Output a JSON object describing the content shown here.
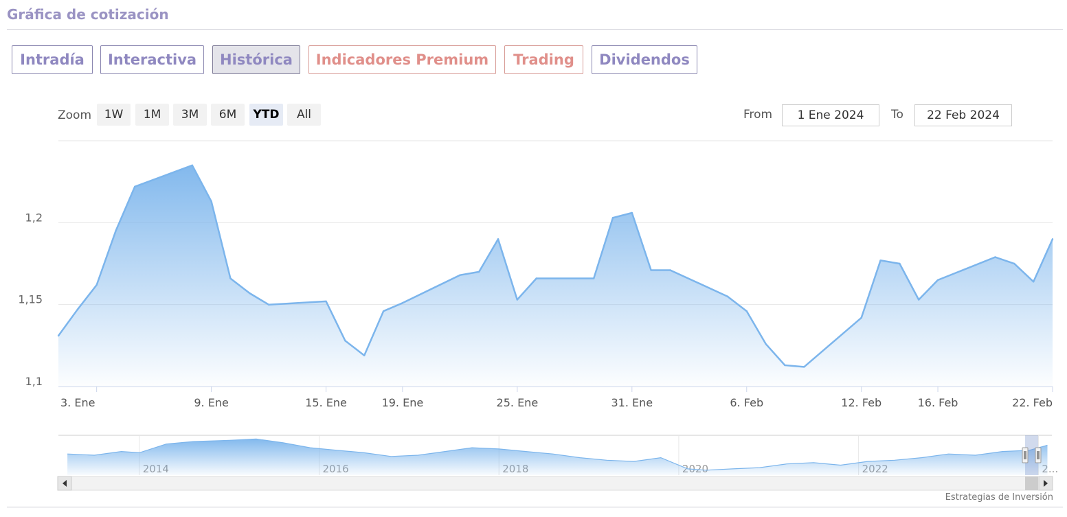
{
  "section_title": "Gráfica de cotización",
  "tabs": [
    {
      "label": "Intradía",
      "active": false,
      "premium": false
    },
    {
      "label": "Interactiva",
      "active": false,
      "premium": false
    },
    {
      "label": "Histórica",
      "active": true,
      "premium": false
    },
    {
      "label": "Indicadores Premium",
      "active": false,
      "premium": true
    },
    {
      "label": "Trading",
      "active": false,
      "premium": true
    },
    {
      "label": "Dividendos",
      "active": false,
      "premium": false
    }
  ],
  "zoom": {
    "label": "Zoom",
    "buttons": [
      "1W",
      "1M",
      "3M",
      "6M",
      "YTD",
      "All"
    ],
    "selected": "YTD"
  },
  "range": {
    "from_label": "From",
    "from_value": "1 Ene 2024",
    "to_label": "To",
    "to_value": "22 Feb 2024"
  },
  "credits": "Estrategias de Inversión",
  "colors": {
    "line": "#7cb5ec",
    "tab_text": "#8f88c0",
    "premium_text": "#e08f8a"
  },
  "chart_data": {
    "type": "area",
    "xlabel": "",
    "ylabel": "",
    "ylim": [
      1.1,
      1.25
    ],
    "yticks": [
      1.1,
      1.15,
      1.2
    ],
    "ytick_labels": [
      "1,1",
      "1,15",
      "1,2"
    ],
    "xlim": [
      "2024-01-01",
      "2024-02-22"
    ],
    "xticks": [
      "2024-01-03",
      "2024-01-09",
      "2024-01-15",
      "2024-01-19",
      "2024-01-25",
      "2024-01-31",
      "2024-02-06",
      "2024-02-12",
      "2024-02-16",
      "2024-02-22"
    ],
    "xtick_labels": [
      "3. Ene",
      "9. Ene",
      "15. Ene",
      "19. Ene",
      "25. Ene",
      "31. Ene",
      "6. Feb",
      "12. Feb",
      "16. Feb",
      "22. Feb"
    ],
    "grid": true,
    "series": [
      {
        "x": [
          "2024-01-01",
          "2024-01-02",
          "2024-01-03",
          "2024-01-04",
          "2024-01-05",
          "2024-01-08",
          "2024-01-09",
          "2024-01-10",
          "2024-01-11",
          "2024-01-12",
          "2024-01-15",
          "2024-01-16",
          "2024-01-17",
          "2024-01-18",
          "2024-01-19",
          "2024-01-22",
          "2024-01-23",
          "2024-01-24",
          "2024-01-25",
          "2024-01-26",
          "2024-01-29",
          "2024-01-30",
          "2024-01-31",
          "2024-02-01",
          "2024-02-02",
          "2024-02-05",
          "2024-02-06",
          "2024-02-07",
          "2024-02-08",
          "2024-02-09",
          "2024-02-12",
          "2024-02-13",
          "2024-02-14",
          "2024-02-15",
          "2024-02-16",
          "2024-02-19",
          "2024-02-20",
          "2024-02-21",
          "2024-02-22"
        ],
        "y": [
          1.131,
          1.147,
          1.162,
          1.195,
          1.222,
          1.235,
          1.213,
          1.166,
          1.157,
          1.15,
          1.152,
          1.128,
          1.119,
          1.146,
          1.151,
          1.168,
          1.17,
          1.19,
          1.153,
          1.166,
          1.166,
          1.203,
          1.206,
          1.171,
          1.171,
          1.155,
          1.146,
          1.126,
          1.113,
          1.112,
          1.142,
          1.177,
          1.175,
          1.153,
          1.165,
          1.179,
          1.175,
          1.164,
          1.19
        ]
      }
    ],
    "navigator": {
      "type": "area",
      "x_labels": [
        "2014",
        "2016",
        "2018",
        "2020",
        "2022",
        "2..."
      ],
      "x_years": [
        2014,
        2016,
        2018,
        2020,
        2022,
        2024
      ],
      "x": [
        2013.2,
        2013.5,
        2013.8,
        2014.0,
        2014.3,
        2014.6,
        2015.0,
        2015.3,
        2015.6,
        2015.9,
        2016.2,
        2016.5,
        2016.8,
        2017.1,
        2017.4,
        2017.7,
        2018.0,
        2018.3,
        2018.6,
        2018.9,
        2019.2,
        2019.5,
        2019.8,
        2020.1,
        2020.3,
        2020.6,
        2020.9,
        2021.2,
        2021.5,
        2021.8,
        2022.1,
        2022.4,
        2022.7,
        2023.0,
        2023.3,
        2023.6,
        2023.9,
        2024.1
      ],
      "y": [
        1.12,
        1.11,
        1.14,
        1.13,
        1.2,
        1.22,
        1.23,
        1.24,
        1.21,
        1.17,
        1.15,
        1.13,
        1.1,
        1.11,
        1.14,
        1.17,
        1.16,
        1.14,
        1.12,
        1.09,
        1.07,
        1.06,
        1.09,
        1.0,
        0.99,
        1.0,
        1.01,
        1.04,
        1.05,
        1.03,
        1.06,
        1.07,
        1.09,
        1.12,
        1.11,
        1.14,
        1.15,
        1.19
      ]
    }
  }
}
